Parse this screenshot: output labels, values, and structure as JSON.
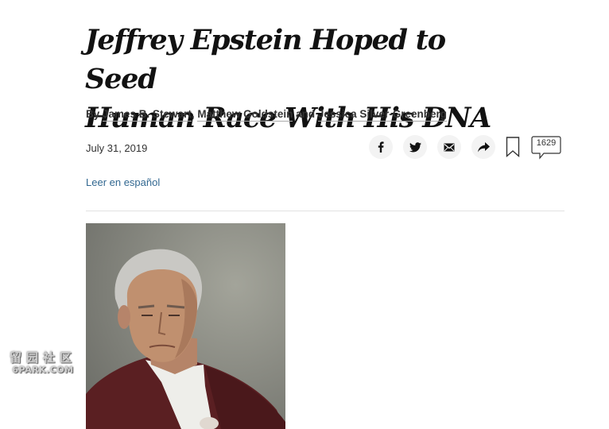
{
  "article": {
    "headline_line1": "Jeffrey Epstein Hoped to Seed",
    "headline_line2": "Human Race With His DNA",
    "byline": {
      "prefix": "By ",
      "author1": "James B. Stewart",
      "sep1": ", ",
      "author2": "Matthew Goldstein",
      "sep2": " and ",
      "author3": "Jessica Silver-Greenberg"
    },
    "date": "July 31, 2019",
    "spanish_link": "Leer en español"
  },
  "toolbar": {
    "icons": [
      "facebook-icon",
      "twitter-icon",
      "email-icon",
      "share-icon",
      "bookmark-icon",
      "comment-icon"
    ],
    "comment_count": "1629"
  },
  "watermark": {
    "top": "留园社区",
    "bottom": "6PARK.COM"
  },
  "colors": {
    "text": "#121212",
    "link": "#326891",
    "divider": "#e2e2e2",
    "icon_bg": "#f3f3f3"
  }
}
